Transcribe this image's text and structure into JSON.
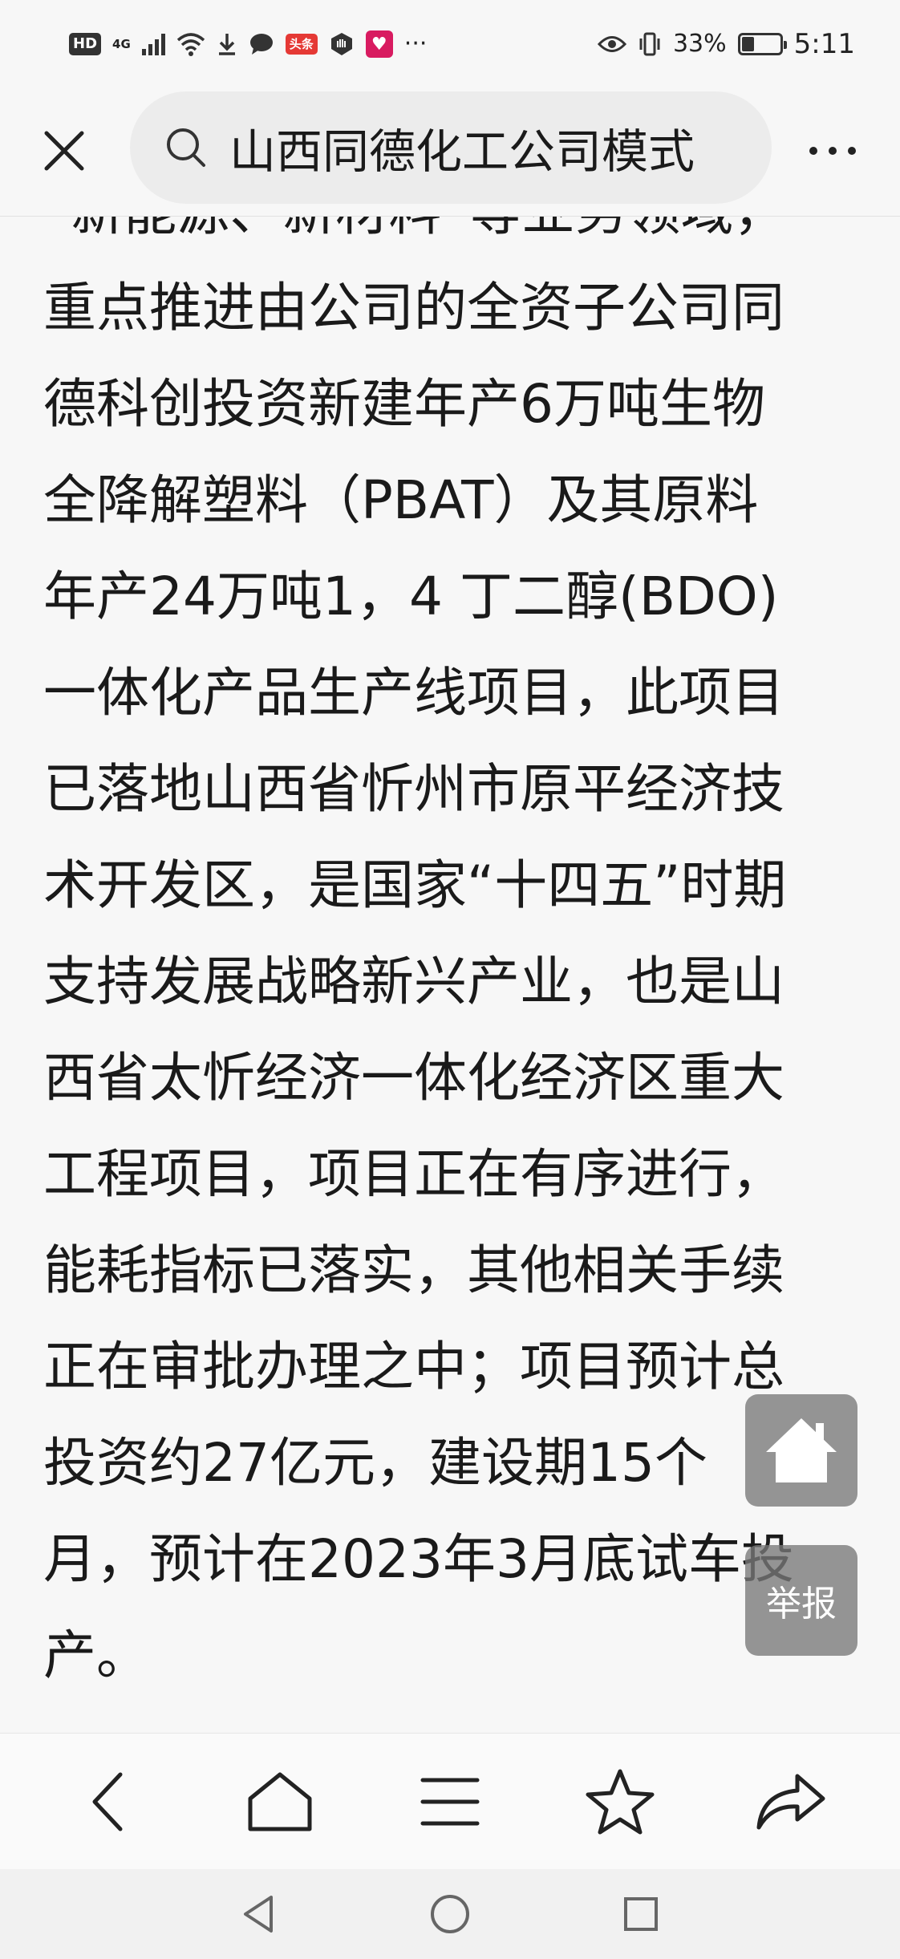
{
  "status_bar": {
    "hd": "HD",
    "network": "4G",
    "notification_badge": "头条",
    "more": "···",
    "battery_level": "33%",
    "battery_fraction": 0.33,
    "time": "5:11"
  },
  "search": {
    "query": "山西同德化工公司模式"
  },
  "article": {
    "lines": [
      "“新能源、新材料”等业务领域，",
      "重点推进由公司的全资子公司同",
      "德科创投资新建年产6万吨生物",
      "全降解塑料（PBAT）及其原料",
      "年产24万吨1，4 丁二醇(BDO)",
      "一体化产品生产线项目，此项目",
      "已落地山西省忻州市原平经济技",
      "术开发区，是国家“十四五”时期",
      "支持发展战略新兴产业，也是山",
      "西省太忻经济一体化经济区重大",
      "工程项目，项目正在有序进行，",
      "能耗指标已落实，其他相关手续",
      "正在审批办理之中；项目预计总",
      "投资约27亿元，建设期15个",
      "月，预计在2023年3月底试车投",
      "产。"
    ]
  },
  "floating": {
    "report_label": "举报"
  },
  "icons": {
    "close": "close-icon",
    "search": "search-icon",
    "more": "more-dots-icon",
    "home_float": "home-icon",
    "back": "chevron-left-icon",
    "home": "home-outline-icon",
    "menu": "menu-icon",
    "favorite": "star-icon",
    "share": "share-icon",
    "sys_back": "triangle-back-icon",
    "sys_home": "circle-home-icon",
    "sys_recents": "square-recents-icon"
  },
  "colors": {
    "background": "#f7f7f7",
    "search_box": "#ececec",
    "text": "#1a1a1a",
    "float_button": "#787878"
  }
}
